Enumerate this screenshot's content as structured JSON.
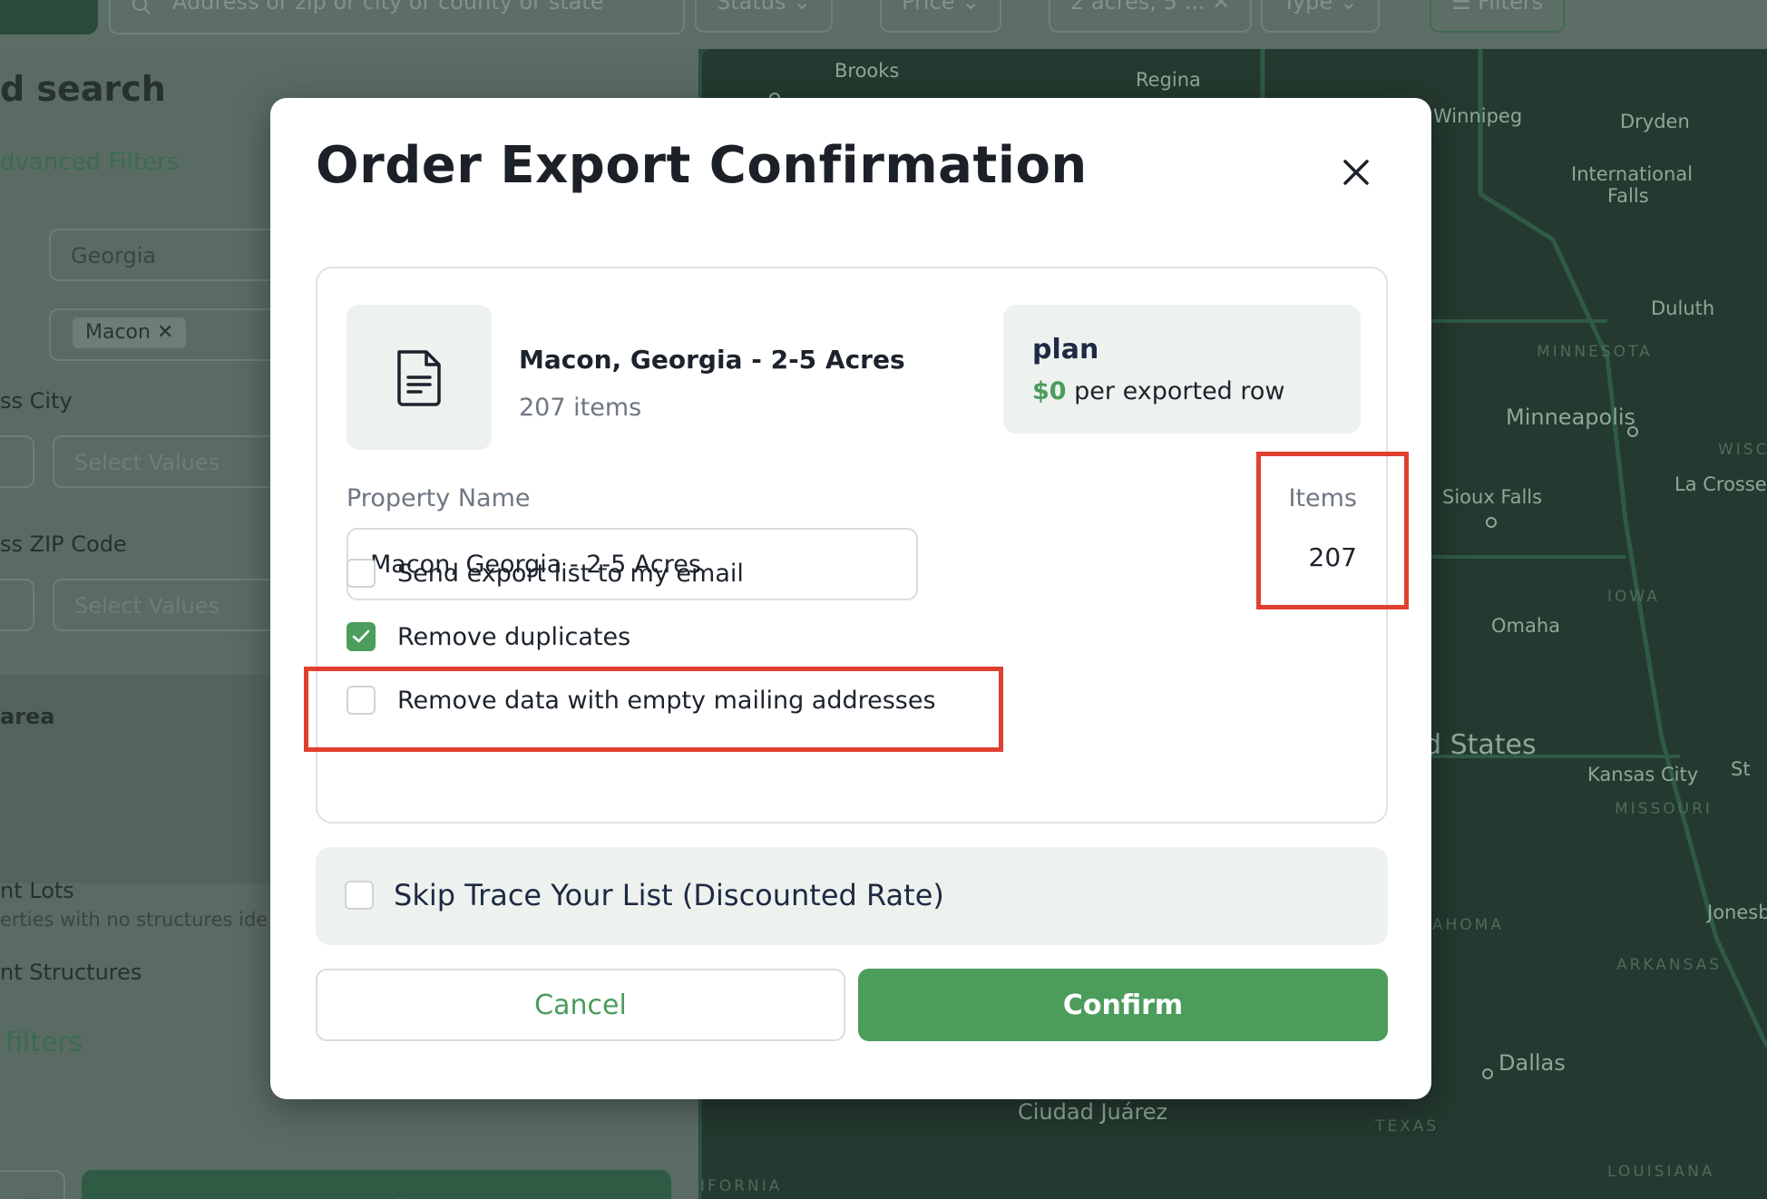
{
  "background": {
    "search_placeholder": "Address or zip or city or county or state",
    "filter_pills": [
      "Status",
      "Price",
      "2 acres, 5 ...",
      "Type",
      "Filters"
    ],
    "sidebar": {
      "title": "d search",
      "advanced_filters": "dvanced Filters",
      "state_value": "Georgia",
      "county_tag": "Macon",
      "city_label": "ss City",
      "city_placeholder": "Select Values",
      "zip_label": "ss ZIP Code",
      "zip_placeholder": "Select Values",
      "area_label": "area",
      "vacant_lots": "nt Lots",
      "vacant_lots_desc": "erties with no structures ide",
      "vacant_structures": "nt Structures",
      "more_filters": "filters",
      "clear_all": "all",
      "apply": "Apply"
    },
    "map_labels": [
      "Brooks",
      "Regina",
      "Winnipeg",
      "Dryden",
      "International",
      "Falls",
      "Duluth",
      "Minneapolis",
      "Sioux Falls",
      "La Crosse",
      "Omaha",
      "d States",
      "Kansas City",
      "St",
      "Jonesb",
      "Dallas",
      "Ciudad Juárez"
    ],
    "map_states": [
      "MINNESOTA",
      "IOWA",
      "MISSOURI",
      "LAHOMA",
      "ARKANSAS",
      "TEXAS",
      "LOUISIANA",
      "WISC",
      "IFORNIA"
    ]
  },
  "modal": {
    "title": "Order Export Confirmation",
    "file": {
      "name": "Macon, Georgia - 2-5 Acres",
      "count": "207 items"
    },
    "plan": {
      "title": "plan",
      "amount": "$0",
      "unit": "per exported row"
    },
    "property_name_label": "Property Name",
    "property_name_value": "Macon, Georgia - 2-5 Acres",
    "items_label": "Items",
    "items_value": "207",
    "options": [
      {
        "label": "Send export list to my email",
        "checked": false
      },
      {
        "label": "Remove duplicates",
        "checked": true
      },
      {
        "label": "Remove data with empty mailing addresses",
        "checked": false
      }
    ],
    "skip_trace": {
      "label": "Skip Trace Your List (Discounted Rate)",
      "checked": false
    },
    "cancel_label": "Cancel",
    "confirm_label": "Confirm"
  },
  "colors": {
    "accent_green": "#4c9c5c",
    "highlight_red": "#e0402f",
    "panel_gray": "#eef2ef"
  }
}
